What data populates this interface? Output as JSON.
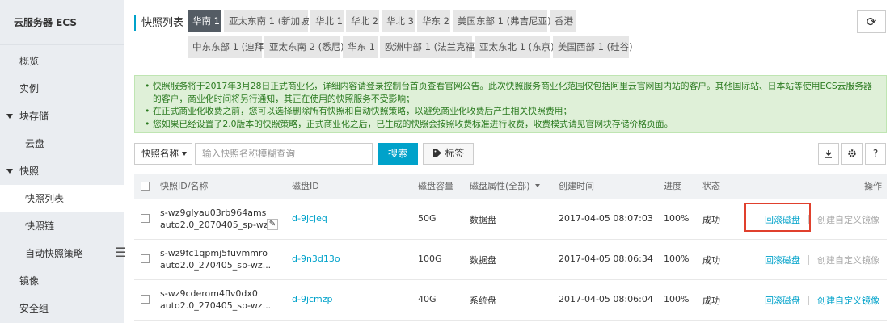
{
  "sidebar": {
    "title": "云服务器 ECS",
    "items": [
      {
        "label": "概览",
        "level": 1
      },
      {
        "label": "实例",
        "level": 1
      },
      {
        "label": "块存储",
        "level": 0,
        "expanded": true
      },
      {
        "label": "云盘",
        "level": 2
      },
      {
        "label": "快照",
        "level": 0,
        "expanded": true
      },
      {
        "label": "快照列表",
        "level": 2,
        "active": true
      },
      {
        "label": "快照链",
        "level": 2
      },
      {
        "label": "自动快照策略",
        "level": 2
      },
      {
        "label": "镜像",
        "level": 1
      },
      {
        "label": "安全组",
        "level": 1
      }
    ],
    "collapse_glyph": "☰"
  },
  "header": {
    "title": "快照列表",
    "regions": [
      "华南 1",
      "亚太东南 1 (新加坡)",
      "华北 1",
      "华北 2",
      "华北 3",
      "华东 2",
      "美国东部 1 (弗吉尼亚)",
      "香港",
      "中东东部 1 (迪拜)",
      "亚太东南 2 (悉尼)",
      "华东 1",
      "欧洲中部 1 (法兰克福)",
      "亚太东北 1 (东京)",
      "美国西部 1 (硅谷)"
    ],
    "active_region": "华南 1",
    "refresh_icon": "refresh-icon"
  },
  "notice": {
    "lines": [
      "快照服务将于2017年3月28日正式商业化，详细内容请登录控制台首页查看官网公告。此次快照服务商业化范围仅包括阿里云官网国内站的客户。其他国际站、日本站等使用ECS云服务器的客户，商业化时间将另行通知，其正在使用的快照服务不受影响；",
      "在正式商业化收费之前，您可以选择删除所有快照和自动快照策略，以避免商业化收费后产生相关快照费用；",
      "您如果已经设置了2.0版本的快照策略，正式商业化之后，已生成的快照会按照收费标准进行收费，收费模式请见官网块存储价格页面。"
    ]
  },
  "toolbar": {
    "filter_label": "快照名称",
    "search_placeholder": "输入快照名称模糊查询",
    "search_label": "搜索",
    "tag_label": "标签",
    "help_label": "?"
  },
  "table": {
    "headers": {
      "id": "快照ID/名称",
      "disk": "磁盘ID",
      "size": "磁盘容量",
      "attr": "磁盘属性(全部)",
      "created": "创建时间",
      "progress": "进度",
      "status": "状态",
      "ops": "操作"
    },
    "rows": [
      {
        "id": "s-wz9glyau03rb964ams",
        "name": "auto2.0_2070405_sp-wz...",
        "disk": "d-9jcjeq",
        "size": "50G",
        "attr": "数据盘",
        "created": "2017-04-05 08:07:03",
        "progress": "100%",
        "status": "成功",
        "rollback": "回滚磁盘",
        "image": "创建自定义镜像",
        "image_enabled": false,
        "highlight": true
      },
      {
        "id": "s-wz9fc1qpmj5fuvmmro",
        "name": "auto2.0_270405_sp-wz...",
        "disk": "d-9n3d13o",
        "size": "100G",
        "attr": "数据盘",
        "created": "2017-04-05 08:06:34",
        "progress": "100%",
        "status": "成功",
        "rollback": "回滚磁盘",
        "image": "创建自定义镜像",
        "image_enabled": false,
        "highlight": false
      },
      {
        "id": "s-wz9cderom4flv0dx0",
        "name": "auto2.0_270405_sp-wz...",
        "disk": "d-9jcmzp",
        "size": "40G",
        "attr": "系统盘",
        "created": "2017-04-05 08:06:04",
        "progress": "100%",
        "status": "成功",
        "rollback": "回滚磁盘",
        "image": "创建自定义镜像",
        "image_enabled": true,
        "highlight": false
      }
    ]
  }
}
